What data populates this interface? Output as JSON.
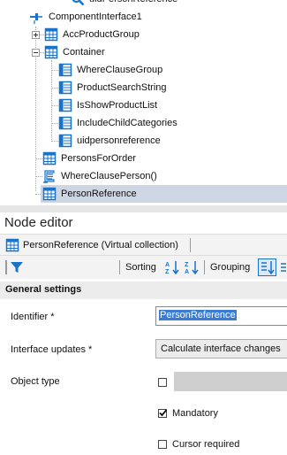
{
  "tree": {
    "items": [
      {
        "label": "uidPersonReference",
        "icon": "magnifier-icon"
      },
      {
        "label": "ComponentInterface1",
        "icon": "component-interface-icon"
      },
      {
        "label": "AccProductGroup",
        "icon": "collection-icon"
      },
      {
        "label": "Container",
        "icon": "collection-icon"
      },
      {
        "label": "WhereClauseGroup",
        "icon": "property-icon"
      },
      {
        "label": "ProductSearchString",
        "icon": "property-icon"
      },
      {
        "label": "IsShowProductList",
        "icon": "property-icon"
      },
      {
        "label": "IncludeChildCategories",
        "icon": "property-icon"
      },
      {
        "label": "uidpersonreference",
        "icon": "property-icon"
      },
      {
        "label": "PersonsForOrder",
        "icon": "collection-icon"
      },
      {
        "label": "WhereClausePerson()",
        "icon": "script-icon"
      },
      {
        "label": "PersonReference",
        "icon": "collection-icon",
        "selected": true
      }
    ]
  },
  "node_editor": {
    "title": "Node editor",
    "breadcrumb": "PersonReference (Virtual collection)",
    "toolbar": {
      "sorting_label": "Sorting",
      "grouping_label": "Grouping"
    },
    "section_title": "General settings",
    "fields": {
      "identifier": {
        "label": "Identifier *",
        "value": "PersonReference"
      },
      "interface_updates": {
        "label": "Interface updates *",
        "value": "Calculate interface changes"
      },
      "object_type": {
        "label": "Object type",
        "checked": false
      },
      "mandatory": {
        "label": "Mandatory",
        "checked": true
      },
      "cursor_required": {
        "label": "Cursor required",
        "checked": false
      }
    }
  },
  "colors": {
    "accent": "#1a73c9",
    "selection": "#cfd6e3",
    "highlight": "#3a7bd5"
  }
}
